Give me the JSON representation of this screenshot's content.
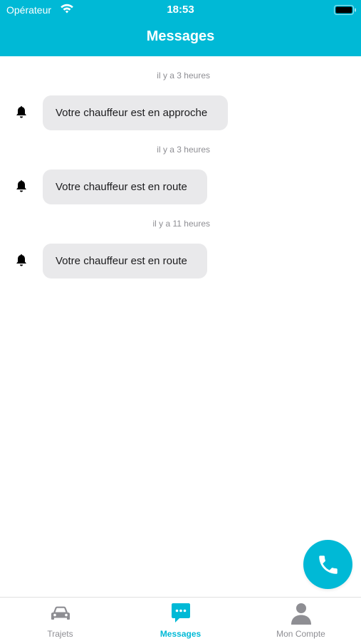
{
  "status_bar": {
    "carrier": "Opérateur",
    "time": "18:53"
  },
  "header": {
    "title": "Messages",
    "color": "#00b9d6"
  },
  "messages": [
    {
      "timestamp": "il y a 3 heures",
      "text": "Votre chauffeur est en approche",
      "icon": "bell-icon"
    },
    {
      "timestamp": "il y a 3 heures",
      "text": "Votre chauffeur est en route",
      "icon": "bell-icon"
    },
    {
      "timestamp": "il y a 11 heures",
      "text": "Votre chauffeur est en route",
      "icon": "bell-icon"
    }
  ],
  "call_button": {
    "icon": "phone-icon"
  },
  "tab_bar": {
    "active": "Messages",
    "tabs": [
      {
        "label": "Trajets",
        "icon": "car-icon"
      },
      {
        "label": "Messages",
        "icon": "chat-bubble-icon"
      },
      {
        "label": "Mon Compte",
        "icon": "user-icon"
      }
    ]
  },
  "colors": {
    "accent": "#00b9d6",
    "bubble": "#e9e9eb",
    "inactive_tab": "#8e8e93"
  }
}
